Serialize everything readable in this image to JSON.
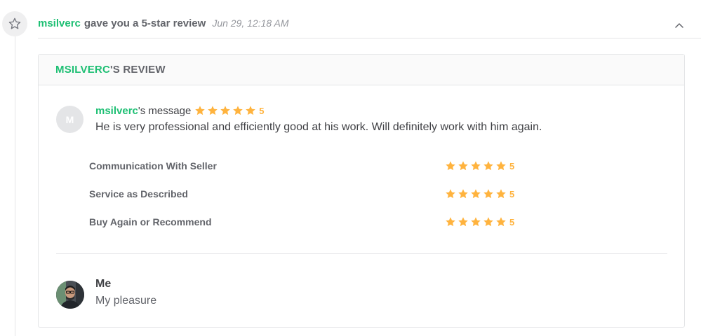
{
  "event": {
    "username": "msilverc",
    "action": "gave you a 5-star review",
    "timestamp": "Jun 29, 12:18 AM",
    "icon": "star-outline-icon"
  },
  "review": {
    "header_name": "MSILVERC",
    "header_suffix": "'S REVIEW",
    "buyer_initial": "M",
    "message_username": "msilverc",
    "message_suffix": "'s message",
    "overall_rating": "5",
    "message": "He is very professional and efficiently good at his work. Will definitely work with him again.",
    "ratings": [
      {
        "label": "Communication With Seller",
        "score": "5"
      },
      {
        "label": "Service as Described",
        "score": "5"
      },
      {
        "label": "Buy Again or Recommend",
        "score": "5"
      }
    ]
  },
  "reply": {
    "name": "Me",
    "text": "My pleasure"
  },
  "colors": {
    "accent": "#1dbf73",
    "star": "#ffb33e",
    "text": "#404145",
    "muted": "#62646a",
    "border": "#e4e5e7"
  }
}
